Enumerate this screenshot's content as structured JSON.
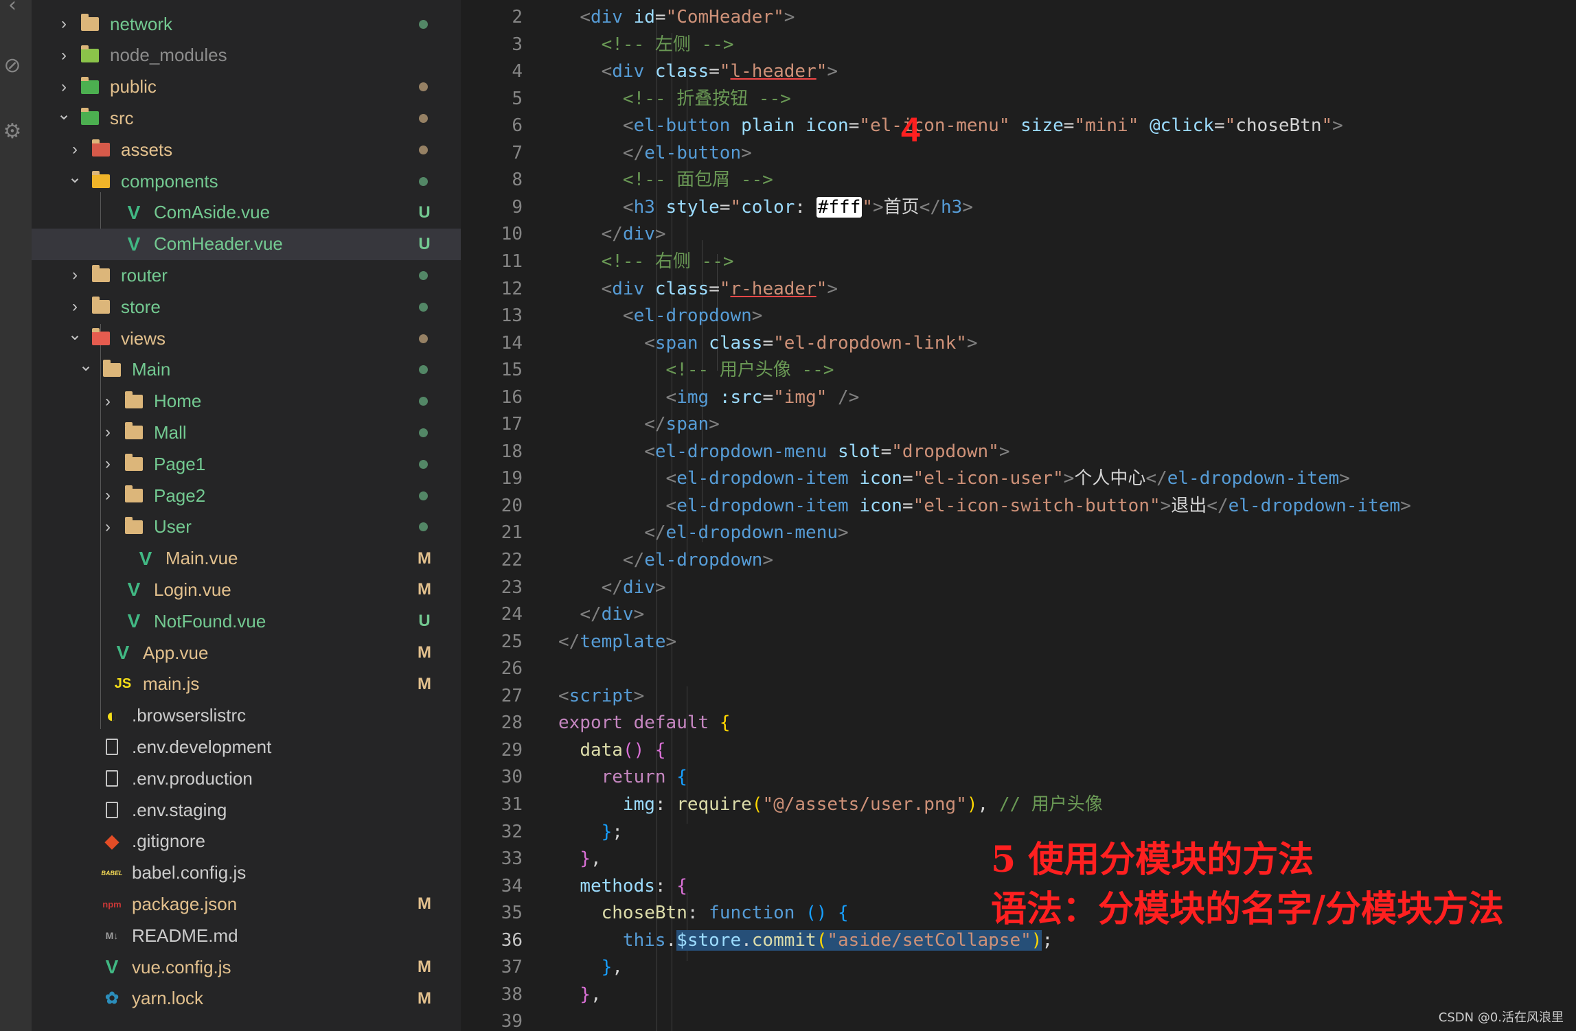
{
  "sidebar": {
    "items": [
      {
        "name": "network",
        "type": "folder",
        "color": "#73c991",
        "status": "dot"
      },
      {
        "name": "node_modules",
        "type": "folder-node",
        "color": "#8c8c8c",
        "status": ""
      },
      {
        "name": "public",
        "type": "folder-public",
        "color": "#e2c08d",
        "status": "dot"
      },
      {
        "name": "src",
        "type": "folder-src",
        "color": "#e2c08d",
        "status": "dot"
      },
      {
        "name": "assets",
        "type": "folder-assets",
        "color": "#e2c08d",
        "status": "dot"
      },
      {
        "name": "components",
        "type": "folder-components",
        "color": "#73c991",
        "status": "dot"
      },
      {
        "name": "ComAside.vue",
        "type": "vue",
        "color": "#73c991",
        "status": "U"
      },
      {
        "name": "ComHeader.vue",
        "type": "vue",
        "color": "#73c991",
        "status": "U"
      },
      {
        "name": "router",
        "type": "folder",
        "color": "#73c991",
        "status": "dot"
      },
      {
        "name": "store",
        "type": "folder",
        "color": "#73c991",
        "status": "dot"
      },
      {
        "name": "views",
        "type": "folder-views",
        "color": "#e2c08d",
        "status": "dot"
      },
      {
        "name": "Main",
        "type": "folder-open",
        "color": "#73c991",
        "status": "dot"
      },
      {
        "name": "Home",
        "type": "folder",
        "color": "#73c991",
        "status": "dot"
      },
      {
        "name": "Mall",
        "type": "folder",
        "color": "#73c991",
        "status": "dot"
      },
      {
        "name": "Page1",
        "type": "folder",
        "color": "#73c991",
        "status": "dot"
      },
      {
        "name": "Page2",
        "type": "folder",
        "color": "#73c991",
        "status": "dot"
      },
      {
        "name": "User",
        "type": "folder",
        "color": "#73c991",
        "status": "dot"
      },
      {
        "name": "Main.vue",
        "type": "vue",
        "color": "#e2c08d",
        "status": "M"
      },
      {
        "name": "Login.vue",
        "type": "vue",
        "color": "#e2c08d",
        "status": "M"
      },
      {
        "name": "NotFound.vue",
        "type": "vue",
        "color": "#73c991",
        "status": "U"
      },
      {
        "name": "App.vue",
        "type": "vue",
        "color": "#e2c08d",
        "status": "M"
      },
      {
        "name": "main.js",
        "type": "js",
        "color": "#e2c08d",
        "status": "M"
      },
      {
        "name": ".browserslistrc",
        "type": "browserslist",
        "color": "#cccccc",
        "status": ""
      },
      {
        "name": ".env.development",
        "type": "file",
        "color": "#cccccc",
        "status": ""
      },
      {
        "name": ".env.production",
        "type": "file",
        "color": "#cccccc",
        "status": ""
      },
      {
        "name": ".env.staging",
        "type": "file",
        "color": "#cccccc",
        "status": ""
      },
      {
        "name": ".gitignore",
        "type": "git",
        "color": "#cccccc",
        "status": ""
      },
      {
        "name": "babel.config.js",
        "type": "babel",
        "color": "#cccccc",
        "status": ""
      },
      {
        "name": "package.json",
        "type": "npm",
        "color": "#e2c08d",
        "status": "M"
      },
      {
        "name": "README.md",
        "type": "md",
        "color": "#cccccc",
        "status": ""
      },
      {
        "name": "vue.config.js",
        "type": "vueconfig",
        "color": "#e2c08d",
        "status": "M"
      },
      {
        "name": "yarn.lock",
        "type": "yarn",
        "color": "#e2c08d",
        "status": "M"
      }
    ]
  },
  "editor": {
    "active_line": 36,
    "line_numbers": [
      "2",
      "3",
      "4",
      "5",
      "6",
      "7",
      "8",
      "9",
      "10",
      "11",
      "12",
      "13",
      "14",
      "15",
      "16",
      "17",
      "18",
      "19",
      "20",
      "21",
      "22",
      "23",
      "24",
      "25",
      "26",
      "27",
      "28",
      "29",
      "30",
      "31",
      "32",
      "33",
      "34",
      "35",
      "36",
      "37",
      "38",
      "39"
    ],
    "tokens": [
      [
        [
          "  ",
          "t-txt"
        ],
        [
          "<",
          "t-br"
        ],
        [
          "div",
          "t-tag"
        ],
        [
          " ",
          "t-txt"
        ],
        [
          "id",
          "t-attr"
        ],
        [
          "=",
          "t-txt"
        ],
        [
          "\"ComHeader\"",
          "t-str"
        ],
        [
          ">",
          "t-br"
        ]
      ],
      [
        [
          "    ",
          "t-txt"
        ],
        [
          "<!-- 左侧 -->",
          "t-cmt"
        ]
      ],
      [
        [
          "    ",
          "t-txt"
        ],
        [
          "<",
          "t-br"
        ],
        [
          "div",
          "t-tag"
        ],
        [
          " ",
          "t-txt"
        ],
        [
          "class",
          "t-attr"
        ],
        [
          "=",
          "t-txt"
        ],
        [
          "\"",
          "t-str"
        ],
        [
          "l-header",
          "t-str underline-red"
        ],
        [
          "\"",
          "t-str"
        ],
        [
          ">",
          "t-br"
        ]
      ],
      [
        [
          "      ",
          "t-txt"
        ],
        [
          "<!-- 折叠按钮 -->",
          "t-cmt"
        ]
      ],
      [
        [
          "      ",
          "t-txt"
        ],
        [
          "<",
          "t-br"
        ],
        [
          "el-button",
          "t-tag"
        ],
        [
          " ",
          "t-txt"
        ],
        [
          "plain",
          "t-attr"
        ],
        [
          " ",
          "t-txt"
        ],
        [
          "icon",
          "t-attr"
        ],
        [
          "=",
          "t-txt"
        ],
        [
          "\"el-icon-menu\"",
          "t-str"
        ],
        [
          " ",
          "t-txt"
        ],
        [
          "size",
          "t-attr"
        ],
        [
          "=",
          "t-txt"
        ],
        [
          "\"mini\"",
          "t-str"
        ],
        [
          " ",
          "t-txt"
        ],
        [
          "@click",
          "t-attr"
        ],
        [
          "=",
          "t-txt"
        ],
        [
          "\"",
          "t-str"
        ],
        [
          "choseBtn",
          "t-txt"
        ],
        [
          "\"",
          "t-str"
        ],
        [
          ">",
          "t-br"
        ]
      ],
      [
        [
          "      ",
          "t-txt"
        ],
        [
          "</",
          "t-br"
        ],
        [
          "el-button",
          "t-tag"
        ],
        [
          ">",
          "t-br"
        ]
      ],
      [
        [
          "      ",
          "t-txt"
        ],
        [
          "<!-- 面包屑 -->",
          "t-cmt"
        ]
      ],
      [
        [
          "      ",
          "t-txt"
        ],
        [
          "<",
          "t-br"
        ],
        [
          "h3",
          "t-tag"
        ],
        [
          " ",
          "t-txt"
        ],
        [
          "style",
          "t-attr"
        ],
        [
          "=",
          "t-txt"
        ],
        [
          "\"",
          "t-str"
        ],
        [
          "color",
          "t-attr"
        ],
        [
          ": ",
          "t-txt"
        ],
        [
          "#fff",
          "t-txt color-box"
        ],
        [
          "\"",
          "t-str"
        ],
        [
          ">",
          "t-br"
        ],
        [
          "首页",
          "t-txt"
        ],
        [
          "</",
          "t-br"
        ],
        [
          "h3",
          "t-tag"
        ],
        [
          ">",
          "t-br"
        ]
      ],
      [
        [
          "    ",
          "t-txt"
        ],
        [
          "</",
          "t-br"
        ],
        [
          "div",
          "t-tag"
        ],
        [
          ">",
          "t-br"
        ]
      ],
      [
        [
          "    ",
          "t-txt"
        ],
        [
          "<!-- 右侧 -->",
          "t-cmt"
        ]
      ],
      [
        [
          "    ",
          "t-txt"
        ],
        [
          "<",
          "t-br"
        ],
        [
          "div",
          "t-tag"
        ],
        [
          " ",
          "t-txt"
        ],
        [
          "class",
          "t-attr"
        ],
        [
          "=",
          "t-txt"
        ],
        [
          "\"",
          "t-str"
        ],
        [
          "r-header",
          "t-str underline-red"
        ],
        [
          "\"",
          "t-str"
        ],
        [
          ">",
          "t-br"
        ]
      ],
      [
        [
          "      ",
          "t-txt"
        ],
        [
          "<",
          "t-br"
        ],
        [
          "el-dropdown",
          "t-tag"
        ],
        [
          ">",
          "t-br"
        ]
      ],
      [
        [
          "        ",
          "t-txt"
        ],
        [
          "<",
          "t-br"
        ],
        [
          "span",
          "t-tag"
        ],
        [
          " ",
          "t-txt"
        ],
        [
          "class",
          "t-attr"
        ],
        [
          "=",
          "t-txt"
        ],
        [
          "\"el-dropdown-link\"",
          "t-str"
        ],
        [
          ">",
          "t-br"
        ]
      ],
      [
        [
          "          ",
          "t-txt"
        ],
        [
          "<!-- 用户头像 -->",
          "t-cmt"
        ]
      ],
      [
        [
          "          ",
          "t-txt"
        ],
        [
          "<",
          "t-br"
        ],
        [
          "img",
          "t-tag"
        ],
        [
          " ",
          "t-txt"
        ],
        [
          ":src",
          "t-attr"
        ],
        [
          "=",
          "t-txt"
        ],
        [
          "\"img\"",
          "t-str"
        ],
        [
          " ",
          "t-txt"
        ],
        [
          "/>",
          "t-br"
        ]
      ],
      [
        [
          "        ",
          "t-txt"
        ],
        [
          "</",
          "t-br"
        ],
        [
          "span",
          "t-tag"
        ],
        [
          ">",
          "t-br"
        ]
      ],
      [
        [
          "        ",
          "t-txt"
        ],
        [
          "<",
          "t-br"
        ],
        [
          "el-dropdown-menu",
          "t-tag"
        ],
        [
          " ",
          "t-txt"
        ],
        [
          "slot",
          "t-attr"
        ],
        [
          "=",
          "t-txt"
        ],
        [
          "\"dropdown\"",
          "t-str"
        ],
        [
          ">",
          "t-br"
        ]
      ],
      [
        [
          "          ",
          "t-txt"
        ],
        [
          "<",
          "t-br"
        ],
        [
          "el-dropdown-item",
          "t-tag"
        ],
        [
          " ",
          "t-txt"
        ],
        [
          "icon",
          "t-attr"
        ],
        [
          "=",
          "t-txt"
        ],
        [
          "\"el-icon-user\"",
          "t-str"
        ],
        [
          ">",
          "t-br"
        ],
        [
          "个人中心",
          "t-txt"
        ],
        [
          "</",
          "t-br"
        ],
        [
          "el-dropdown-item",
          "t-tag"
        ],
        [
          ">",
          "t-br"
        ]
      ],
      [
        [
          "          ",
          "t-txt"
        ],
        [
          "<",
          "t-br"
        ],
        [
          "el-dropdown-item",
          "t-tag"
        ],
        [
          " ",
          "t-txt"
        ],
        [
          "icon",
          "t-attr"
        ],
        [
          "=",
          "t-txt"
        ],
        [
          "\"el-icon-switch-button\"",
          "t-str"
        ],
        [
          ">",
          "t-br"
        ],
        [
          "退出",
          "t-txt"
        ],
        [
          "</",
          "t-br"
        ],
        [
          "el-dropdown-item",
          "t-tag"
        ],
        [
          ">",
          "t-br"
        ]
      ],
      [
        [
          "        ",
          "t-txt"
        ],
        [
          "</",
          "t-br"
        ],
        [
          "el-dropdown-menu",
          "t-tag"
        ],
        [
          ">",
          "t-br"
        ]
      ],
      [
        [
          "      ",
          "t-txt"
        ],
        [
          "</",
          "t-br"
        ],
        [
          "el-dropdown",
          "t-tag"
        ],
        [
          ">",
          "t-br"
        ]
      ],
      [
        [
          "    ",
          "t-txt"
        ],
        [
          "</",
          "t-br"
        ],
        [
          "div",
          "t-tag"
        ],
        [
          ">",
          "t-br"
        ]
      ],
      [
        [
          "  ",
          "t-txt"
        ],
        [
          "</",
          "t-br"
        ],
        [
          "div",
          "t-tag"
        ],
        [
          ">",
          "t-br"
        ]
      ],
      [
        [
          "</",
          "t-br"
        ],
        [
          "template",
          "t-tag"
        ],
        [
          ">",
          "t-br"
        ]
      ],
      [],
      [
        [
          "<",
          "t-br"
        ],
        [
          "script",
          "t-tag"
        ],
        [
          ">",
          "t-br"
        ]
      ],
      [
        [
          "export",
          "t-kw"
        ],
        [
          " ",
          "t-txt"
        ],
        [
          "default",
          "t-kw"
        ],
        [
          " ",
          "t-txt"
        ],
        [
          "{",
          "t-b1"
        ]
      ],
      [
        [
          "  ",
          "t-txt"
        ],
        [
          "data",
          "t-fn"
        ],
        [
          "()",
          "t-b2"
        ],
        [
          " ",
          "t-txt"
        ],
        [
          "{",
          "t-b2"
        ]
      ],
      [
        [
          "    ",
          "t-txt"
        ],
        [
          "return",
          "t-kw"
        ],
        [
          " ",
          "t-txt"
        ],
        [
          "{",
          "t-b3"
        ]
      ],
      [
        [
          "      ",
          "t-txt"
        ],
        [
          "img",
          "t-attr"
        ],
        [
          ": ",
          "t-txt"
        ],
        [
          "require",
          "t-fn"
        ],
        [
          "(",
          "t-b1"
        ],
        [
          "\"@/assets/user.png\"",
          "t-str"
        ],
        [
          ")",
          "t-b1"
        ],
        [
          ", ",
          "t-txt"
        ],
        [
          "// 用户头像",
          "t-cmt"
        ]
      ],
      [
        [
          "    ",
          "t-txt"
        ],
        [
          "}",
          "t-b3"
        ],
        [
          ";",
          "t-txt"
        ]
      ],
      [
        [
          "  ",
          "t-txt"
        ],
        [
          "}",
          "t-b2"
        ],
        [
          ",",
          "t-txt"
        ]
      ],
      [
        [
          "  ",
          "t-txt"
        ],
        [
          "methods",
          "t-attr"
        ],
        [
          ": ",
          "t-txt"
        ],
        [
          "{",
          "t-b2"
        ]
      ],
      [
        [
          "    ",
          "t-txt"
        ],
        [
          "choseBtn",
          "t-fn"
        ],
        [
          ": ",
          "t-txt"
        ],
        [
          "function",
          "t-kw2"
        ],
        [
          " ",
          "t-txt"
        ],
        [
          "()",
          "t-b3"
        ],
        [
          " ",
          "t-txt"
        ],
        [
          "{",
          "t-b3"
        ]
      ],
      [
        [
          "      ",
          "t-txt"
        ],
        [
          "this",
          "t-kw2"
        ],
        [
          ".",
          "t-txt"
        ],
        [
          "$store",
          "t-attr hl-sel"
        ],
        [
          ".",
          "t-txt hl-sel"
        ],
        [
          "commit",
          "t-fn hl-sel"
        ],
        [
          "(",
          "t-b1 hl-sel"
        ],
        [
          "\"aside/setCollapse\"",
          "t-str hl-sel"
        ],
        [
          ")",
          "t-b1 hl-sel"
        ],
        [
          ";",
          "t-txt"
        ]
      ],
      [
        [
          "    ",
          "t-txt"
        ],
        [
          "}",
          "t-b3"
        ],
        [
          ",",
          "t-txt"
        ]
      ],
      [
        [
          "  ",
          "t-txt"
        ],
        [
          "}",
          "t-b2"
        ],
        [
          ",",
          "t-txt"
        ]
      ],
      []
    ]
  },
  "annotations": {
    "step4": "4",
    "step5_title": "5 使用分模块的方法",
    "step5_syntax": "语法：分模块的名字/分模块方法",
    "color": "#ff2020"
  },
  "watermark": "CSDN @0.活在风浪里"
}
